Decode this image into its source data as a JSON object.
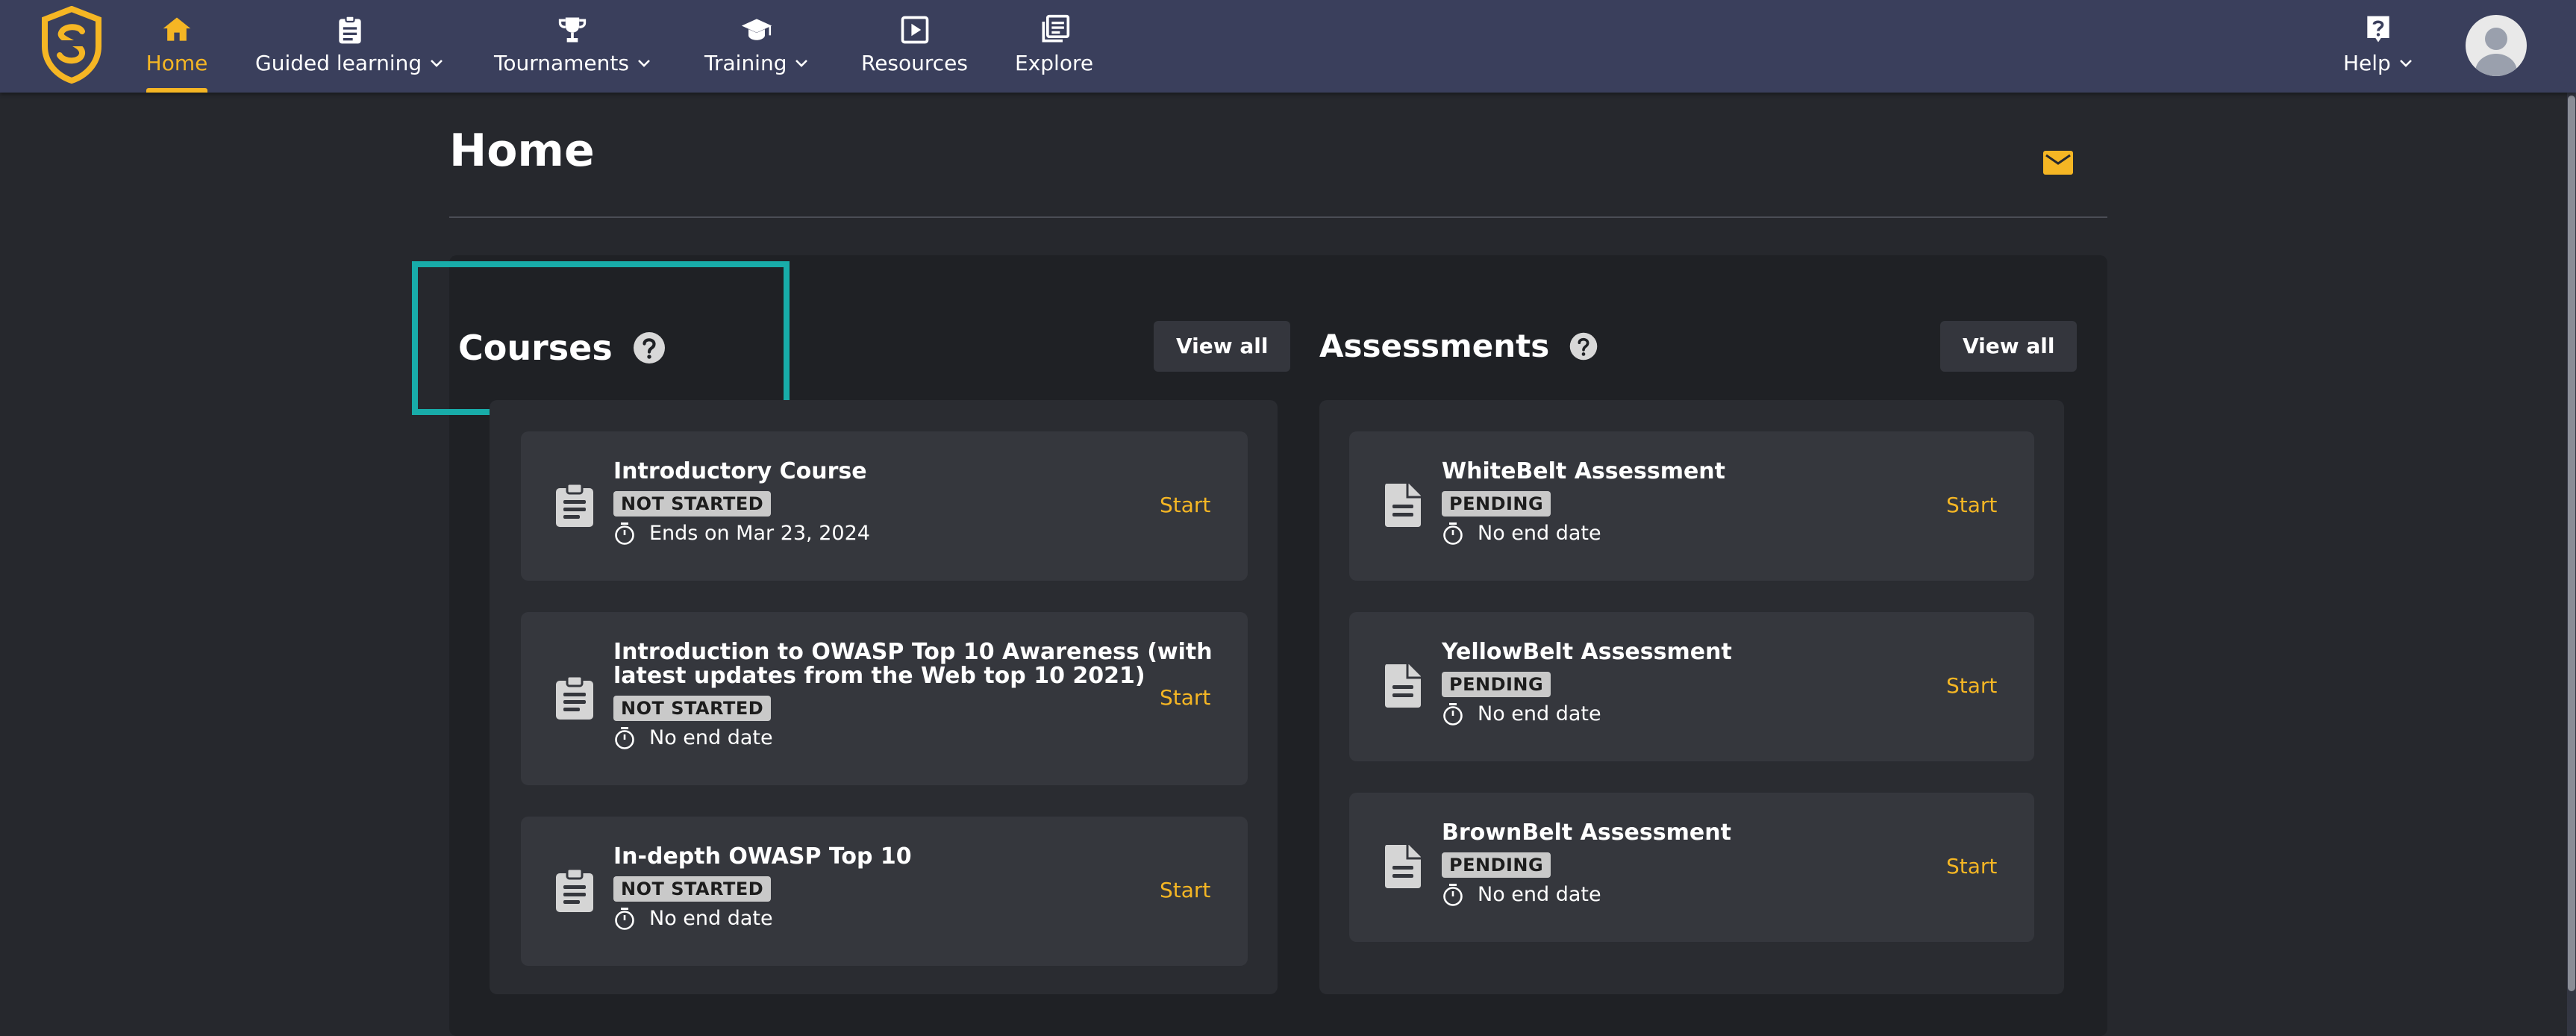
{
  "brand": {
    "accent": "#f5b624",
    "highlight": "#18aca9",
    "nav_bg": "#3a3f5c"
  },
  "nav": {
    "items": [
      {
        "label": "Home",
        "icon": "home-icon",
        "dropdown": false,
        "active": true
      },
      {
        "label": "Guided learning",
        "icon": "clipboard-icon",
        "dropdown": true
      },
      {
        "label": "Tournaments",
        "icon": "trophy-icon",
        "dropdown": true
      },
      {
        "label": "Training",
        "icon": "graduation-cap-icon",
        "dropdown": true
      },
      {
        "label": "Resources",
        "icon": "play-box-icon",
        "dropdown": false
      },
      {
        "label": "Explore",
        "icon": "stacked-pages-icon",
        "dropdown": false
      }
    ],
    "help": {
      "label": "Help",
      "icon": "question-box-icon",
      "dropdown": true
    },
    "avatar_icon": "user-avatar-icon"
  },
  "page": {
    "title": "Home",
    "mail_icon": "mail-icon"
  },
  "courses": {
    "title": "Courses",
    "view_all": "View all",
    "items": [
      {
        "title": "Introductory Course",
        "status": "NOT STARTED",
        "due": "Ends on Mar 23, 2024",
        "action": "Start"
      },
      {
        "title_line1": "Introduction to OWASP Top 10 Awareness (with",
        "title_line2": "latest updates from the Web top 10 2021)",
        "status": "NOT STARTED",
        "due": "No end date",
        "action": "Start"
      },
      {
        "title": "In-depth OWASP Top 10",
        "status": "NOT STARTED",
        "due": "No end date",
        "action": "Start"
      }
    ]
  },
  "assessments": {
    "title": "Assessments",
    "view_all": "View all",
    "items": [
      {
        "title": "WhiteBelt Assessment",
        "status": "PENDING",
        "due": "No end date",
        "action": "Start"
      },
      {
        "title": "YellowBelt Assessment",
        "status": "PENDING",
        "due": "No end date",
        "action": "Start"
      },
      {
        "title": "BrownBelt Assessment",
        "status": "PENDING",
        "due": "No end date",
        "action": "Start"
      }
    ]
  }
}
